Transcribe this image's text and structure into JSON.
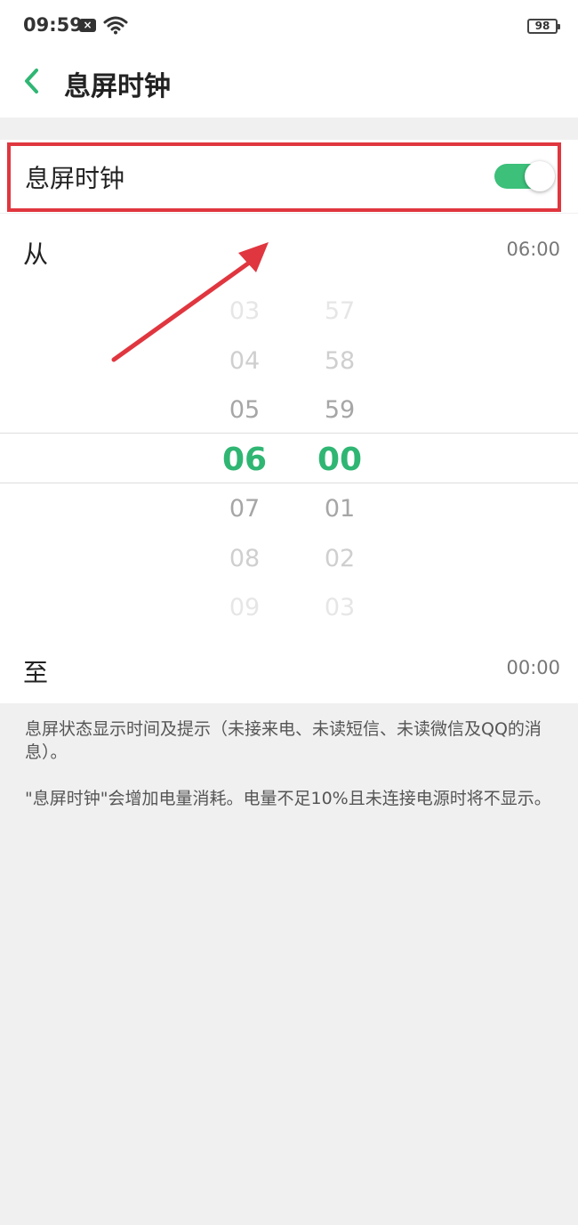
{
  "status_bar": {
    "time": "09:59",
    "battery": "98",
    "notification_icon": "mail-x-icon",
    "wifi_icon": "wifi-icon"
  },
  "header": {
    "title": "息屏时钟",
    "back_icon": "chevron-left-icon"
  },
  "toggle": {
    "label": "息屏时钟",
    "enabled": true,
    "accent": "#3cc07a",
    "highlight_color": "#e0363f"
  },
  "from": {
    "label": "从",
    "value": "06:00"
  },
  "to": {
    "label": "至",
    "value": "00:00"
  },
  "picker": {
    "hours": [
      "03",
      "04",
      "05",
      "06",
      "07",
      "08",
      "09"
    ],
    "minutes": [
      "57",
      "58",
      "59",
      "00",
      "01",
      "02",
      "03"
    ],
    "selected_index": 3,
    "selected_color": "#2fb673"
  },
  "description": {
    "line1": "息屏状态显示时间及提示（未接来电、未读短信、未读微信及QQ的消息）。",
    "line2": "\"息屏时钟\"会增加电量消耗。电量不足10%且未连接电源时将不显示。"
  }
}
